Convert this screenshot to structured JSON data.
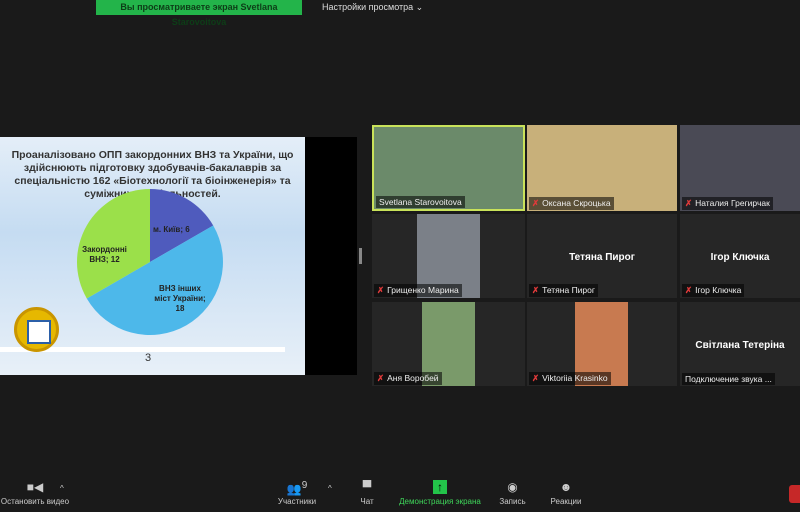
{
  "top": {
    "banner": "Вы просматриваете экран Svetlana Starovoitova",
    "view_options": "Настройки просмотра ⌄"
  },
  "slide": {
    "title": "Проаналізовано ОПП  закордонних ВНЗ та України, що здійснюють підготовку здобувачів-бакалаврів за спеціальністю 162 «Біотехнології та біоінженерія» та суміжних спеціальностей.",
    "page": "3"
  },
  "chart_data": {
    "type": "pie",
    "title": "Проаналізовано ОПП закордонних ВНЗ та України",
    "slices": [
      {
        "label": "м. Київ; 6",
        "name": "м. Київ",
        "value": 6,
        "color": "#4f5bbd"
      },
      {
        "label": "ВНЗ інших міст України; 18",
        "name": "ВНЗ інших міст України",
        "value": 18,
        "color": "#4db8ea"
      },
      {
        "label": "Закордонні ВНЗ; 12",
        "name": "Закордонні ВНЗ",
        "value": 12,
        "color": "#9be04a"
      }
    ]
  },
  "participants": [
    {
      "name": "Svetlana Starovoitova",
      "muted": false,
      "video": true,
      "active": true
    },
    {
      "name": "Оксана Скроцька",
      "muted": true,
      "video": true
    },
    {
      "name": "Наталия Грегирчак",
      "muted": true,
      "video": true
    },
    {
      "name": "Грищенко Марина",
      "muted": true,
      "video": true
    },
    {
      "name": "Тетяна Пирог",
      "muted": true,
      "video": false
    },
    {
      "name": "Ігор Ключка",
      "muted": true,
      "video": false
    },
    {
      "name": "Аня Воробей",
      "muted": true,
      "video": true
    },
    {
      "name": "Viktoriia Krasinko",
      "muted": true,
      "video": true
    },
    {
      "name": "Світлана Тетеріна",
      "status": "Подключение звука ...",
      "video": false
    }
  ],
  "toolbar": {
    "stop_video": "Остановить видео",
    "participants": "Участники",
    "participants_count": "9",
    "chat": "Чат",
    "share": "Демонстрация экрана",
    "record": "Запись",
    "reactions": "Реакции",
    "caret": "^"
  },
  "mute_icon": "✗"
}
